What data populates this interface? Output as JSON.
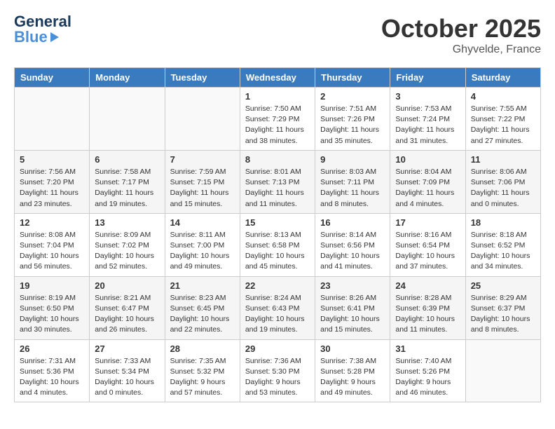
{
  "header": {
    "logo_general": "General",
    "logo_blue": "Blue",
    "month": "October 2025",
    "location": "Ghyvelde, France"
  },
  "weekdays": [
    "Sunday",
    "Monday",
    "Tuesday",
    "Wednesday",
    "Thursday",
    "Friday",
    "Saturday"
  ],
  "weeks": [
    [
      {
        "day": "",
        "info": ""
      },
      {
        "day": "",
        "info": ""
      },
      {
        "day": "",
        "info": ""
      },
      {
        "day": "1",
        "info": "Sunrise: 7:50 AM\nSunset: 7:29 PM\nDaylight: 11 hours\nand 38 minutes."
      },
      {
        "day": "2",
        "info": "Sunrise: 7:51 AM\nSunset: 7:26 PM\nDaylight: 11 hours\nand 35 minutes."
      },
      {
        "day": "3",
        "info": "Sunrise: 7:53 AM\nSunset: 7:24 PM\nDaylight: 11 hours\nand 31 minutes."
      },
      {
        "day": "4",
        "info": "Sunrise: 7:55 AM\nSunset: 7:22 PM\nDaylight: 11 hours\nand 27 minutes."
      }
    ],
    [
      {
        "day": "5",
        "info": "Sunrise: 7:56 AM\nSunset: 7:20 PM\nDaylight: 11 hours\nand 23 minutes."
      },
      {
        "day": "6",
        "info": "Sunrise: 7:58 AM\nSunset: 7:17 PM\nDaylight: 11 hours\nand 19 minutes."
      },
      {
        "day": "7",
        "info": "Sunrise: 7:59 AM\nSunset: 7:15 PM\nDaylight: 11 hours\nand 15 minutes."
      },
      {
        "day": "8",
        "info": "Sunrise: 8:01 AM\nSunset: 7:13 PM\nDaylight: 11 hours\nand 11 minutes."
      },
      {
        "day": "9",
        "info": "Sunrise: 8:03 AM\nSunset: 7:11 PM\nDaylight: 11 hours\nand 8 minutes."
      },
      {
        "day": "10",
        "info": "Sunrise: 8:04 AM\nSunset: 7:09 PM\nDaylight: 11 hours\nand 4 minutes."
      },
      {
        "day": "11",
        "info": "Sunrise: 8:06 AM\nSunset: 7:06 PM\nDaylight: 11 hours\nand 0 minutes."
      }
    ],
    [
      {
        "day": "12",
        "info": "Sunrise: 8:08 AM\nSunset: 7:04 PM\nDaylight: 10 hours\nand 56 minutes."
      },
      {
        "day": "13",
        "info": "Sunrise: 8:09 AM\nSunset: 7:02 PM\nDaylight: 10 hours\nand 52 minutes."
      },
      {
        "day": "14",
        "info": "Sunrise: 8:11 AM\nSunset: 7:00 PM\nDaylight: 10 hours\nand 49 minutes."
      },
      {
        "day": "15",
        "info": "Sunrise: 8:13 AM\nSunset: 6:58 PM\nDaylight: 10 hours\nand 45 minutes."
      },
      {
        "day": "16",
        "info": "Sunrise: 8:14 AM\nSunset: 6:56 PM\nDaylight: 10 hours\nand 41 minutes."
      },
      {
        "day": "17",
        "info": "Sunrise: 8:16 AM\nSunset: 6:54 PM\nDaylight: 10 hours\nand 37 minutes."
      },
      {
        "day": "18",
        "info": "Sunrise: 8:18 AM\nSunset: 6:52 PM\nDaylight: 10 hours\nand 34 minutes."
      }
    ],
    [
      {
        "day": "19",
        "info": "Sunrise: 8:19 AM\nSunset: 6:50 PM\nDaylight: 10 hours\nand 30 minutes."
      },
      {
        "day": "20",
        "info": "Sunrise: 8:21 AM\nSunset: 6:47 PM\nDaylight: 10 hours\nand 26 minutes."
      },
      {
        "day": "21",
        "info": "Sunrise: 8:23 AM\nSunset: 6:45 PM\nDaylight: 10 hours\nand 22 minutes."
      },
      {
        "day": "22",
        "info": "Sunrise: 8:24 AM\nSunset: 6:43 PM\nDaylight: 10 hours\nand 19 minutes."
      },
      {
        "day": "23",
        "info": "Sunrise: 8:26 AM\nSunset: 6:41 PM\nDaylight: 10 hours\nand 15 minutes."
      },
      {
        "day": "24",
        "info": "Sunrise: 8:28 AM\nSunset: 6:39 PM\nDaylight: 10 hours\nand 11 minutes."
      },
      {
        "day": "25",
        "info": "Sunrise: 8:29 AM\nSunset: 6:37 PM\nDaylight: 10 hours\nand 8 minutes."
      }
    ],
    [
      {
        "day": "26",
        "info": "Sunrise: 7:31 AM\nSunset: 5:36 PM\nDaylight: 10 hours\nand 4 minutes."
      },
      {
        "day": "27",
        "info": "Sunrise: 7:33 AM\nSunset: 5:34 PM\nDaylight: 10 hours\nand 0 minutes."
      },
      {
        "day": "28",
        "info": "Sunrise: 7:35 AM\nSunset: 5:32 PM\nDaylight: 9 hours\nand 57 minutes."
      },
      {
        "day": "29",
        "info": "Sunrise: 7:36 AM\nSunset: 5:30 PM\nDaylight: 9 hours\nand 53 minutes."
      },
      {
        "day": "30",
        "info": "Sunrise: 7:38 AM\nSunset: 5:28 PM\nDaylight: 9 hours\nand 49 minutes."
      },
      {
        "day": "31",
        "info": "Sunrise: 7:40 AM\nSunset: 5:26 PM\nDaylight: 9 hours\nand 46 minutes."
      },
      {
        "day": "",
        "info": ""
      }
    ]
  ]
}
